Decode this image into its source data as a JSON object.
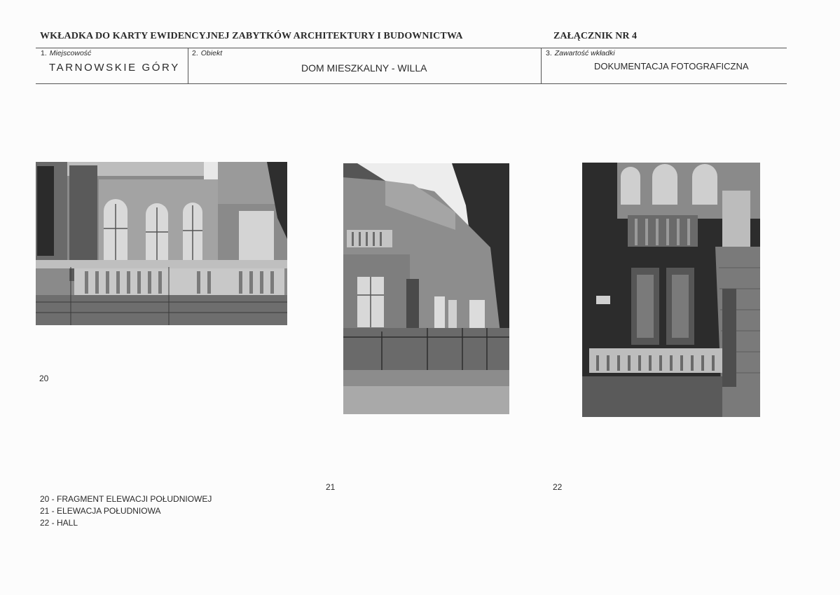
{
  "header": {
    "title": "WKŁADKA DO KARTY EWIDENCYJNEJ ZABYTKÓW ARCHITEKTURY I BUDOWNICTWA",
    "annex": "ZAŁĄCZNIK NR 4"
  },
  "fields": [
    {
      "num": "1.",
      "label": "Miejscowość",
      "value": "TARNOWSKIE GÓRY"
    },
    {
      "num": "2.",
      "label": "Obiekt",
      "value": "DOM MIESZKALNY - WILLA"
    },
    {
      "num": "3.",
      "label": "Zawartość wkładki",
      "value": "DOKUMENTACJA FOTOGRAFICZNA"
    }
  ],
  "photos": [
    {
      "number": "20"
    },
    {
      "number": "21"
    },
    {
      "number": "22"
    }
  ],
  "captions": [
    "20 - FRAGMENT ELEWACJI POŁUDNIOWEJ",
    "21 - ELEWACJA POŁUDNIOWA",
    "22 - HALL"
  ]
}
